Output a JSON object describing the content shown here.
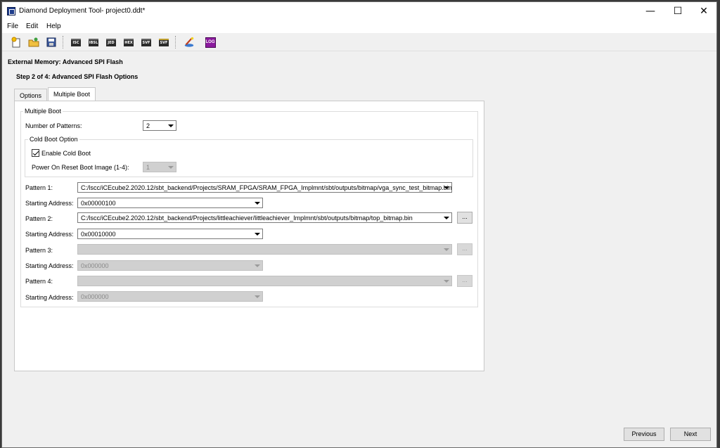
{
  "window": {
    "title": "Diamond Deployment Tool- project0.ddt*"
  },
  "window_controls": {
    "minimize": "—",
    "maximize": "☐",
    "close": "✕"
  },
  "menu": {
    "file": "File",
    "edit": "Edit",
    "help": "Help"
  },
  "toolbar": {
    "isc": "ISC",
    "ibsl": "IBSL",
    "jed": "JED",
    "hex": "HEX",
    "svf": "SVF",
    "svf2": "SVF",
    "log": "LOG",
    "icons": [
      "new-file-icon",
      "open-folder-icon",
      "save-icon",
      "isc-icon",
      "ibsl-icon",
      "jed-icon",
      "hex-icon",
      "svf-icon",
      "svf-bundle-icon",
      "wizard-icon",
      "log-icon"
    ]
  },
  "heading": "External Memory:  Advanced SPI Flash",
  "subheading": "Step 2 of 4: Advanced SPI Flash Options",
  "tabs": {
    "options": "Options",
    "multiple_boot": "Multiple Boot"
  },
  "multiple_boot": {
    "group_label": "Multiple Boot",
    "num_patterns_label": "Number of Patterns:",
    "num_patterns_value": "2",
    "cold_boot_group": "Cold Boot Option",
    "enable_cold_boot_label": "Enable Cold Boot",
    "enable_cold_boot_checked": true,
    "por_label": "Power On Reset Boot Image (1-4):",
    "por_value": "1",
    "pattern1_label": "Pattern 1:",
    "pattern1_value": "C:/lscc/iCEcube2.2020.12/sbt_backend/Projects/SRAM_FPGA/SRAM_FPGA_Implmnt/sbt/outputs/bitmap/vga_sync_test_bitmap.bin",
    "addr1_label": "Starting Address:",
    "addr1_value": "0x00000100",
    "pattern2_label": "Pattern 2:",
    "pattern2_value": "C:/lscc/iCEcube2.2020.12/sbt_backend/Projects/littleachiever/littleachiever_Implmnt/sbt/outputs/bitmap/top_bitmap.bin",
    "addr2_label": "Starting Address:",
    "addr2_value": "0x00010000",
    "pattern3_label": "Pattern 3:",
    "pattern3_value": "",
    "addr3_label": "Starting Address:",
    "addr3_value": "0x000000",
    "pattern4_label": "Pattern 4:",
    "pattern4_value": "",
    "addr4_label": "Starting Address:",
    "addr4_value": "0x000000",
    "browse_label": "..."
  },
  "footer": {
    "previous": "Previous",
    "next": "Next"
  }
}
